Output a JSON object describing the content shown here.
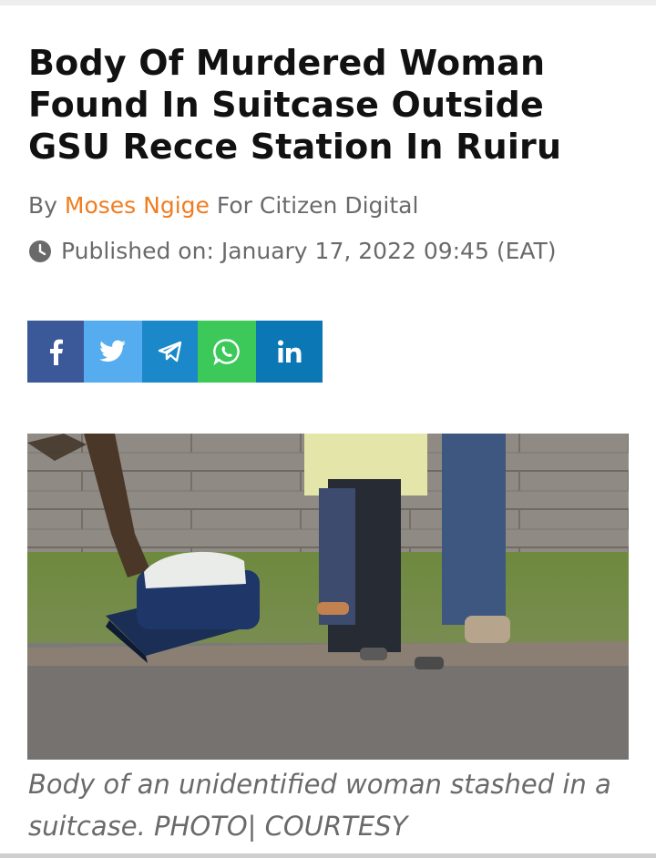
{
  "article": {
    "title": "Body Of Murdered Woman Found In Suitcase Outside GSU Recce Station In Ruiru",
    "byline_prefix": "By",
    "author": "Moses Ngige",
    "byline_suffix": "For Citizen Digital",
    "published_label": "Published on:",
    "published_date": "January 17, 2022 09:45 (EAT)",
    "caption": "Body of an unidentified woman stashed in a suitcase. PHOTO| COURTESY"
  },
  "share": [
    {
      "network": "facebook",
      "icon": "facebook-icon",
      "color": "#3b5998"
    },
    {
      "network": "twitter",
      "icon": "twitter-icon",
      "color": "#55acee"
    },
    {
      "network": "telegram",
      "icon": "telegram-icon",
      "color": "#1a88c9"
    },
    {
      "network": "whatsapp",
      "icon": "whatsapp-icon",
      "color": "#3cc95a"
    },
    {
      "network": "linkedin",
      "icon": "linkedin-icon",
      "color": "#0b77b5"
    }
  ],
  "colors": {
    "author": "#ef7d22",
    "meta_text": "#6a6a6a",
    "title_text": "#111111"
  }
}
